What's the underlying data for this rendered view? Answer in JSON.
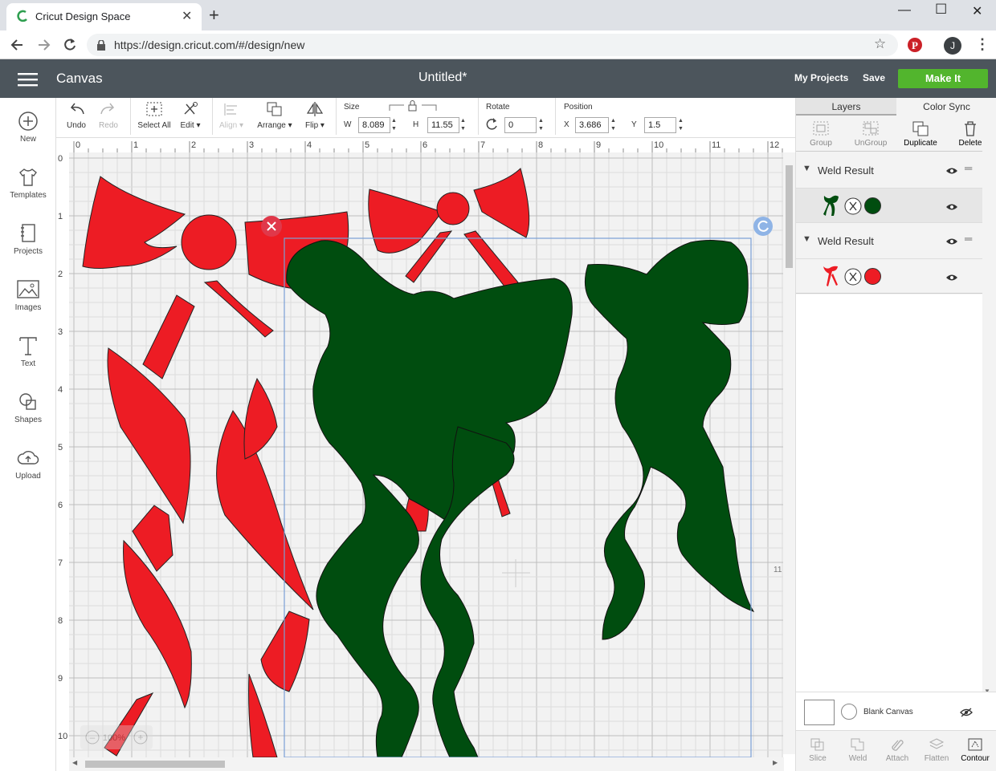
{
  "browser": {
    "tab_title": "Cricut Design Space",
    "url": "https://design.cricut.com/#/design/new",
    "user_initial": "J"
  },
  "header": {
    "section": "Canvas",
    "doc_title": "Untitled*",
    "my_projects": "My Projects",
    "save": "Save",
    "make_it": "Make It"
  },
  "sidebar": {
    "items": [
      {
        "label": "New"
      },
      {
        "label": "Templates"
      },
      {
        "label": "Projects"
      },
      {
        "label": "Images"
      },
      {
        "label": "Text"
      },
      {
        "label": "Shapes"
      },
      {
        "label": "Upload"
      }
    ]
  },
  "toolbar": {
    "undo": "Undo",
    "redo": "Redo",
    "select_all": "Select All",
    "edit": "Edit",
    "align": "Align",
    "arrange": "Arrange",
    "flip": "Flip",
    "size_label": "Size",
    "w_label": "W",
    "w_value": "8.089",
    "h_label": "H",
    "h_value": "11.55",
    "rotate_label": "Rotate",
    "rotate_value": "0",
    "position_label": "Position",
    "x_label": "X",
    "x_value": "3.686",
    "y_label": "Y",
    "y_value": "1.5"
  },
  "canvas": {
    "ruler_top": [
      "0",
      "1",
      "2",
      "3",
      "4",
      "5",
      "6",
      "7",
      "8",
      "9",
      "10",
      "11",
      "12"
    ],
    "ruler_left": [
      "0",
      "1",
      "2",
      "3",
      "4",
      "5",
      "6",
      "7",
      "8",
      "9",
      "10"
    ],
    "height_marker": "11",
    "zoom": "100%",
    "colors": {
      "red": "#ed1c24",
      "green": "#004d0f",
      "selection": "#7aa0d6"
    }
  },
  "panel": {
    "tab_layers": "Layers",
    "tab_color_sync": "Color Sync",
    "group": "Group",
    "ungroup": "UnGroup",
    "duplicate": "Duplicate",
    "delete": "Delete",
    "layers": [
      {
        "name": "Weld Result",
        "color": "#004d0f"
      },
      {
        "name": "Weld Result",
        "color": "#ed1c24"
      }
    ],
    "blank_canvas": "Blank Canvas",
    "bottom": {
      "slice": "Slice",
      "weld": "Weld",
      "attach": "Attach",
      "flatten": "Flatten",
      "contour": "Contour"
    }
  }
}
